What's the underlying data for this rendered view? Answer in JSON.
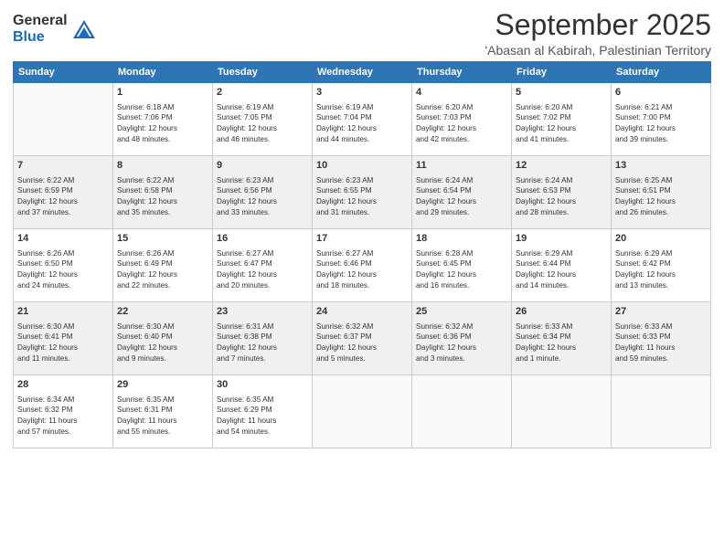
{
  "logo": {
    "general": "General",
    "blue": "Blue"
  },
  "title": "September 2025",
  "location": "'Abasan al Kabirah, Palestinian Territory",
  "weekdays": [
    "Sunday",
    "Monday",
    "Tuesday",
    "Wednesday",
    "Thursday",
    "Friday",
    "Saturday"
  ],
  "weeks": [
    [
      {
        "day": "",
        "info": ""
      },
      {
        "day": "1",
        "info": "Sunrise: 6:18 AM\nSunset: 7:06 PM\nDaylight: 12 hours\nand 48 minutes."
      },
      {
        "day": "2",
        "info": "Sunrise: 6:19 AM\nSunset: 7:05 PM\nDaylight: 12 hours\nand 46 minutes."
      },
      {
        "day": "3",
        "info": "Sunrise: 6:19 AM\nSunset: 7:04 PM\nDaylight: 12 hours\nand 44 minutes."
      },
      {
        "day": "4",
        "info": "Sunrise: 6:20 AM\nSunset: 7:03 PM\nDaylight: 12 hours\nand 42 minutes."
      },
      {
        "day": "5",
        "info": "Sunrise: 6:20 AM\nSunset: 7:02 PM\nDaylight: 12 hours\nand 41 minutes."
      },
      {
        "day": "6",
        "info": "Sunrise: 6:21 AM\nSunset: 7:00 PM\nDaylight: 12 hours\nand 39 minutes."
      }
    ],
    [
      {
        "day": "7",
        "info": "Sunrise: 6:22 AM\nSunset: 6:59 PM\nDaylight: 12 hours\nand 37 minutes."
      },
      {
        "day": "8",
        "info": "Sunrise: 6:22 AM\nSunset: 6:58 PM\nDaylight: 12 hours\nand 35 minutes."
      },
      {
        "day": "9",
        "info": "Sunrise: 6:23 AM\nSunset: 6:56 PM\nDaylight: 12 hours\nand 33 minutes."
      },
      {
        "day": "10",
        "info": "Sunrise: 6:23 AM\nSunset: 6:55 PM\nDaylight: 12 hours\nand 31 minutes."
      },
      {
        "day": "11",
        "info": "Sunrise: 6:24 AM\nSunset: 6:54 PM\nDaylight: 12 hours\nand 29 minutes."
      },
      {
        "day": "12",
        "info": "Sunrise: 6:24 AM\nSunset: 6:53 PM\nDaylight: 12 hours\nand 28 minutes."
      },
      {
        "day": "13",
        "info": "Sunrise: 6:25 AM\nSunset: 6:51 PM\nDaylight: 12 hours\nand 26 minutes."
      }
    ],
    [
      {
        "day": "14",
        "info": "Sunrise: 6:26 AM\nSunset: 6:50 PM\nDaylight: 12 hours\nand 24 minutes."
      },
      {
        "day": "15",
        "info": "Sunrise: 6:26 AM\nSunset: 6:49 PM\nDaylight: 12 hours\nand 22 minutes."
      },
      {
        "day": "16",
        "info": "Sunrise: 6:27 AM\nSunset: 6:47 PM\nDaylight: 12 hours\nand 20 minutes."
      },
      {
        "day": "17",
        "info": "Sunrise: 6:27 AM\nSunset: 6:46 PM\nDaylight: 12 hours\nand 18 minutes."
      },
      {
        "day": "18",
        "info": "Sunrise: 6:28 AM\nSunset: 6:45 PM\nDaylight: 12 hours\nand 16 minutes."
      },
      {
        "day": "19",
        "info": "Sunrise: 6:29 AM\nSunset: 6:44 PM\nDaylight: 12 hours\nand 14 minutes."
      },
      {
        "day": "20",
        "info": "Sunrise: 6:29 AM\nSunset: 6:42 PM\nDaylight: 12 hours\nand 13 minutes."
      }
    ],
    [
      {
        "day": "21",
        "info": "Sunrise: 6:30 AM\nSunset: 6:41 PM\nDaylight: 12 hours\nand 11 minutes."
      },
      {
        "day": "22",
        "info": "Sunrise: 6:30 AM\nSunset: 6:40 PM\nDaylight: 12 hours\nand 9 minutes."
      },
      {
        "day": "23",
        "info": "Sunrise: 6:31 AM\nSunset: 6:38 PM\nDaylight: 12 hours\nand 7 minutes."
      },
      {
        "day": "24",
        "info": "Sunrise: 6:32 AM\nSunset: 6:37 PM\nDaylight: 12 hours\nand 5 minutes."
      },
      {
        "day": "25",
        "info": "Sunrise: 6:32 AM\nSunset: 6:36 PM\nDaylight: 12 hours\nand 3 minutes."
      },
      {
        "day": "26",
        "info": "Sunrise: 6:33 AM\nSunset: 6:34 PM\nDaylight: 12 hours\nand 1 minute."
      },
      {
        "day": "27",
        "info": "Sunrise: 6:33 AM\nSunset: 6:33 PM\nDaylight: 11 hours\nand 59 minutes."
      }
    ],
    [
      {
        "day": "28",
        "info": "Sunrise: 6:34 AM\nSunset: 6:32 PM\nDaylight: 11 hours\nand 57 minutes."
      },
      {
        "day": "29",
        "info": "Sunrise: 6:35 AM\nSunset: 6:31 PM\nDaylight: 11 hours\nand 55 minutes."
      },
      {
        "day": "30",
        "info": "Sunrise: 6:35 AM\nSunset: 6:29 PM\nDaylight: 11 hours\nand 54 minutes."
      },
      {
        "day": "",
        "info": ""
      },
      {
        "day": "",
        "info": ""
      },
      {
        "day": "",
        "info": ""
      },
      {
        "day": "",
        "info": ""
      }
    ]
  ]
}
